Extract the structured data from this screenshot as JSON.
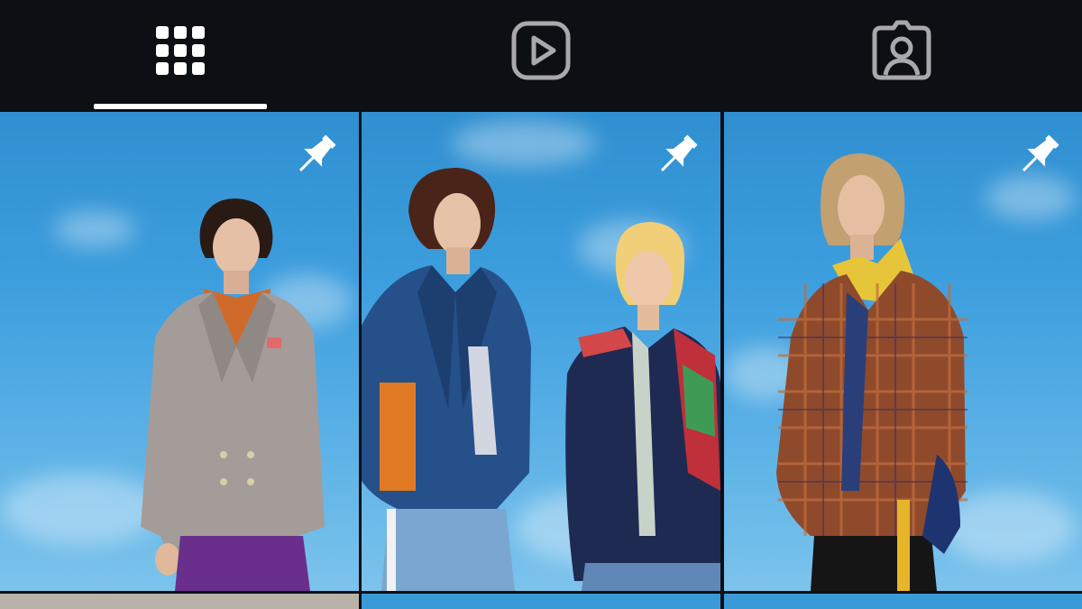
{
  "tabs": [
    {
      "name": "posts",
      "icon": "grid-icon",
      "active": true
    },
    {
      "name": "reels",
      "icon": "reels-play-icon",
      "active": false
    },
    {
      "name": "tagged",
      "icon": "tagged-person-icon",
      "active": false
    }
  ],
  "colors": {
    "background": "#0c0f14",
    "active_icon": "#ffffff",
    "inactive_icon": "#a8a8ad",
    "sky": "#3d9ede"
  },
  "grid": {
    "posts": [
      {
        "pinned": true,
        "pin_icon": "pin-icon",
        "subject": "photo-person-gray-check-suit"
      },
      {
        "pinned": true,
        "pin_icon": "pin-icon",
        "subject": "photo-two-people-blue-jackets"
      },
      {
        "pinned": true,
        "pin_icon": "pin-icon",
        "subject": "photo-person-plaid-jacket"
      }
    ]
  }
}
